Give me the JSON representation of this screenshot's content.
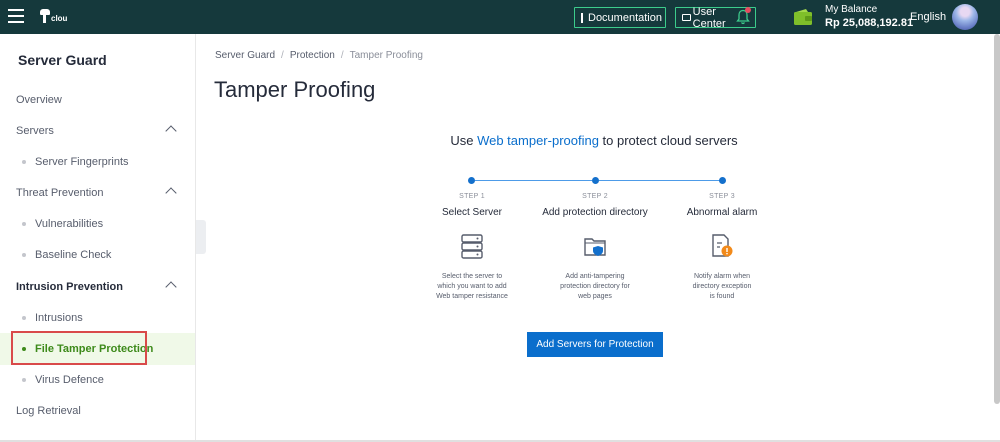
{
  "header": {
    "logo_text": "clou",
    "documentation_label": "Documentation",
    "user_center_label": "User Center",
    "balance_label": "My Balance",
    "balance_value": "Rp 25,088,192.81",
    "language": "English"
  },
  "sidebar": {
    "title": "Server Guard",
    "items": [
      {
        "label": "Overview"
      },
      {
        "label": "Servers"
      },
      {
        "label": "Server Fingerprints"
      },
      {
        "label": "Threat Prevention"
      },
      {
        "label": "Vulnerabilities"
      },
      {
        "label": "Baseline Check"
      },
      {
        "label": "Intrusion Prevention"
      },
      {
        "label": "Intrusions"
      },
      {
        "label": "File Tamper Protection"
      },
      {
        "label": "Virus Defence"
      },
      {
        "label": "Log Retrieval"
      }
    ]
  },
  "breadcrumb": [
    "Server Guard",
    "/",
    "Protection",
    "/",
    "Tamper Proofing"
  ],
  "page_title": "Tamper Proofing",
  "headline": {
    "prefix": "Use ",
    "link": "Web tamper-proofing",
    "suffix": " to protect cloud servers"
  },
  "steps": [
    {
      "step": "STEP 1",
      "name": "Select Server",
      "icon": "server-icon",
      "desc_lines": [
        "Select the server to",
        "which you want to add",
        "Web tamper resistance"
      ]
    },
    {
      "step": "STEP 2",
      "name": "Add protection directory",
      "icon": "folder-shield-icon",
      "desc_lines": [
        "Add anti-tampering",
        "protection directory for",
        "web pages"
      ]
    },
    {
      "step": "STEP 3",
      "name": "Abnormal alarm",
      "icon": "alarm-file-icon",
      "desc_lines": [
        "Notify alarm when",
        "directory exception",
        "is found"
      ]
    }
  ],
  "cta_label": "Add Servers for Protection",
  "colors": {
    "topbar": "#15393c",
    "accent_blue": "#0a6ecc",
    "active_green": "#3d8a1a",
    "highlight_red": "#d94a4a"
  }
}
